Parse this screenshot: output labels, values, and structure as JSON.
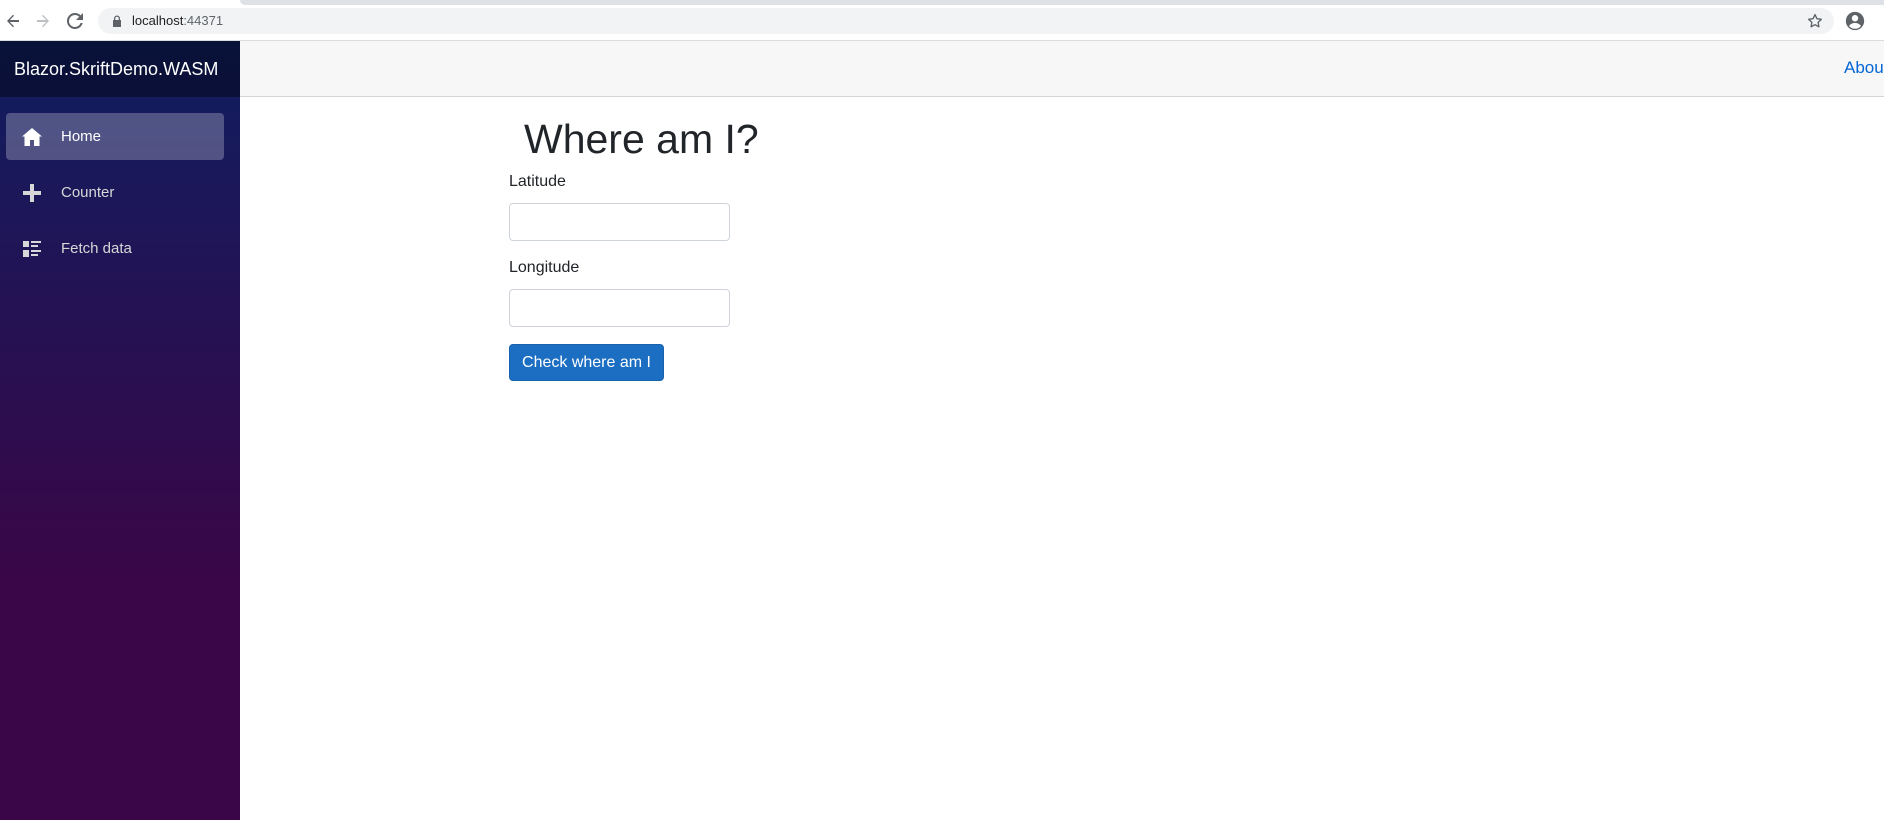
{
  "browser": {
    "url_host": "localhost",
    "url_port": ":44371"
  },
  "sidebar": {
    "brand": "Blazor.SkriftDemo.WASM",
    "items": [
      {
        "label": "Home",
        "icon": "home-icon",
        "active": true
      },
      {
        "label": "Counter",
        "icon": "plus-icon",
        "active": false
      },
      {
        "label": "Fetch data",
        "icon": "list-rich-icon",
        "active": false
      }
    ]
  },
  "top_row": {
    "about_label": "About"
  },
  "main": {
    "title": "Where am I?",
    "latitude_label": "Latitude",
    "latitude_value": "",
    "longitude_label": "Longitude",
    "longitude_value": "",
    "button_label": "Check where am I"
  },
  "colors": {
    "accent": "#1b6ec2",
    "link": "#0366d6",
    "sidebar_top": "#0f1e60",
    "sidebar_bottom": "#3a0647"
  }
}
